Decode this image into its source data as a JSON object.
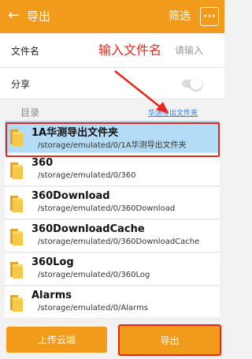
{
  "header": {
    "title": "导出",
    "filter_label": "筛选",
    "more_label": "···",
    "back_icon": "arrow-left-icon"
  },
  "form": {
    "filename_label": "文件名",
    "filename_annotation": "输入文件名",
    "filename_placeholder": "请输入",
    "share_label": "分享",
    "share_enabled": false
  },
  "directory": {
    "label": "目录",
    "link_text": "华测导出文件夹"
  },
  "folders": [
    {
      "name": "1A华测导出文件夹",
      "path": "/storage/emulated/0/1A华测导出文件夹",
      "selected": true
    },
    {
      "name": "360",
      "path": "/storage/emulated/0/360",
      "selected": false
    },
    {
      "name": "360Download",
      "path": "/storage/emulated/0/360Download",
      "selected": false
    },
    {
      "name": "360DownloadCache",
      "path": "/storage/emulated/0/360DownloadCache",
      "selected": false
    },
    {
      "name": "360Log",
      "path": "/storage/emulated/0/360Log",
      "selected": false
    },
    {
      "name": "Alarms",
      "path": "/storage/emulated/0/Alarms",
      "selected": false
    }
  ],
  "footer": {
    "upload_label": "上传云端",
    "export_label": "导出"
  },
  "colors": {
    "accent": "#f29a1a",
    "annotation": "#e8261c",
    "link": "#2a7ee8",
    "selected_row": "#b3dbf5"
  }
}
